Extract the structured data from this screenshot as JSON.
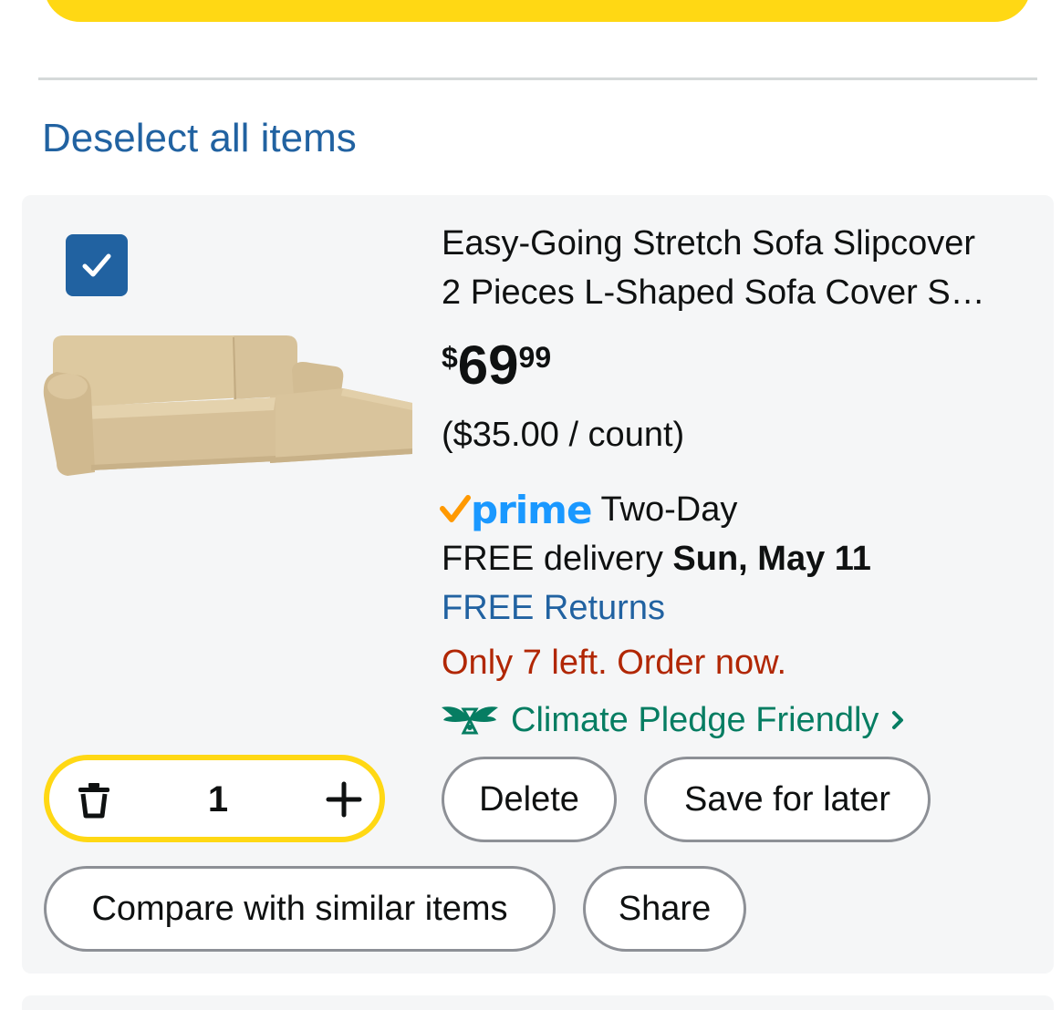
{
  "cart": {
    "deselect_label": "Deselect all items"
  },
  "item": {
    "checked": true,
    "title_line1": "Easy-Going Stretch Sofa Slipcover",
    "title_line2": "2 Pieces L-Shaped Sofa Cover S…",
    "price_symbol": "$",
    "price_whole": "69",
    "price_fraction": "99",
    "unit_price": "($35.00 / count)",
    "prime_label": "prime",
    "prime_speed": "Two-Day",
    "delivery_prefix": "FREE delivery",
    "delivery_date": "Sun, May 11",
    "free_returns": "FREE Returns",
    "stock_message": "Only 7 left. Order now.",
    "climate_label": "Climate Pledge Friendly",
    "quantity": "1",
    "image_icon": "sofa-slipcover-image"
  },
  "actions": {
    "delete_label": "Delete",
    "save_label": "Save for later",
    "compare_label": "Compare with similar items",
    "share_label": "Share"
  },
  "colors": {
    "link_blue": "#2162a1",
    "prime_blue": "#1a98ff",
    "prime_check": "#ff9900",
    "stock_red": "#b12704",
    "climate_green": "#067d62",
    "accent_yellow": "#ffd814",
    "card_bg": "#f5f6f7"
  }
}
